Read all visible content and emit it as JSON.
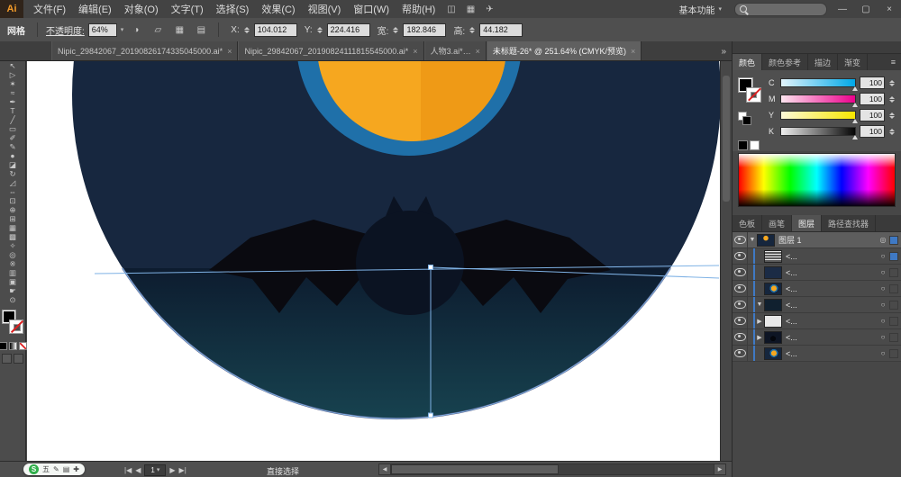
{
  "window": {
    "app": "Ai",
    "workspace_switcher": "基本功能",
    "caret": "▾",
    "minimize": "—",
    "restore": "▢",
    "close": "×"
  },
  "menubar": {
    "items": [
      "文件(F)",
      "编辑(E)",
      "对象(O)",
      "文字(T)",
      "选择(S)",
      "效果(C)",
      "视图(V)",
      "窗口(W)",
      "帮助(H)"
    ],
    "icons": [
      {
        "name": "bridge",
        "glyph": "◫"
      },
      {
        "name": "arrange-documents",
        "glyph": "▦"
      },
      {
        "name": "cs-live",
        "glyph": "✈"
      }
    ]
  },
  "controlbar": {
    "selection_type": "网格",
    "opacity_label": "不透明度:",
    "opacity_value": "64%",
    "icons": [
      {
        "name": "recolor-artwork",
        "glyph": "◑"
      },
      {
        "name": "graphic-style",
        "glyph": "▱"
      },
      {
        "name": "mesh-grid",
        "glyph": "▦"
      },
      {
        "name": "align",
        "glyph": "▤"
      }
    ],
    "fields": [
      {
        "label": "X:",
        "value": "104.012"
      },
      {
        "label": "Y:",
        "value": "224.416"
      },
      {
        "label": "宽:",
        "value": "182.846"
      },
      {
        "label": "高:",
        "value": "44.182"
      }
    ]
  },
  "tabbar": {
    "tabs": [
      {
        "label": "Nipic_29842067_20190826174335045000.ai*"
      },
      {
        "label": "Nipic_29842067_20190824111815545000.ai*"
      },
      {
        "label": "人物3.ai*…"
      },
      {
        "label": "未标题-26* @ 251.64% (CMYK/预览)"
      }
    ],
    "close_glyph": "×",
    "overflow_glyph": "»"
  },
  "toolbar": {
    "tools": [
      {
        "name": "selection",
        "glyph": "↖"
      },
      {
        "name": "direct-selection",
        "glyph": "▷"
      },
      {
        "name": "magic-wand",
        "glyph": "✶"
      },
      {
        "name": "lasso",
        "glyph": "≈"
      },
      {
        "name": "pen",
        "glyph": "✒"
      },
      {
        "name": "type",
        "glyph": "T"
      },
      {
        "name": "line-segment",
        "glyph": "╱"
      },
      {
        "name": "rectangle",
        "glyph": "▭"
      },
      {
        "name": "paintbrush",
        "glyph": "✐"
      },
      {
        "name": "pencil",
        "glyph": "✎"
      },
      {
        "name": "blob-brush",
        "glyph": "●"
      },
      {
        "name": "eraser",
        "glyph": "◪"
      },
      {
        "name": "rotate",
        "glyph": "↻"
      },
      {
        "name": "scale",
        "glyph": "◿"
      },
      {
        "name": "width",
        "glyph": "⇔"
      },
      {
        "name": "free-transform",
        "glyph": "⊡"
      },
      {
        "name": "shape-builder",
        "glyph": "⊕"
      },
      {
        "name": "perspective-grid",
        "glyph": "⊞"
      },
      {
        "name": "mesh",
        "glyph": "▦"
      },
      {
        "name": "gradient",
        "glyph": "▩"
      },
      {
        "name": "eyedropper",
        "glyph": "✧"
      },
      {
        "name": "blend",
        "glyph": "◎"
      },
      {
        "name": "symbol-sprayer",
        "glyph": "※"
      },
      {
        "name": "column-graph",
        "glyph": "▥"
      },
      {
        "name": "artboard",
        "glyph": "▣"
      },
      {
        "name": "hand",
        "glyph": "☛"
      },
      {
        "name": "zoom",
        "glyph": "⊙"
      }
    ]
  },
  "canvas": {
    "colors": {
      "big_circle": "#17273F",
      "lower_top": "#0D1C2F",
      "lower_bottom": "#17424F",
      "rim": "#565A80",
      "ring": "#1F70A9",
      "moon": "#F6A71F",
      "moon_shade": "#EF9A16",
      "bat_wing": "#0A0A10",
      "bat_body": "#0B1322",
      "selection": "#7FB2E5"
    }
  },
  "right_panel": {
    "color_panel": {
      "tabs": [
        "颜色",
        "颜色参考",
        "描边",
        "渐变"
      ],
      "menu_glyph": "≡",
      "channels": [
        {
          "label": "C",
          "value": "100"
        },
        {
          "label": "M",
          "value": "100"
        },
        {
          "label": "Y",
          "value": "100"
        },
        {
          "label": "K",
          "value": "100"
        }
      ]
    },
    "dock_tabs": {
      "tabs": [
        "色板",
        "画笔",
        "图层",
        "路径查找器"
      ]
    },
    "layers": {
      "rows": [
        {
          "label": "图层 1",
          "caret": "▼",
          "target": "◎"
        },
        {
          "label": "<...",
          "caret": "",
          "target": "○"
        },
        {
          "label": "<...",
          "caret": "",
          "target": "○"
        },
        {
          "label": "<...",
          "caret": "",
          "target": "○"
        },
        {
          "label": "<...",
          "caret": "▼",
          "target": "○"
        },
        {
          "label": "<...",
          "caret": "▶",
          "target": "○"
        },
        {
          "label": "<...",
          "caret": "▶",
          "target": "○"
        },
        {
          "label": "<...",
          "caret": "",
          "target": "○"
        }
      ]
    }
  },
  "statusbar": {
    "ime": {
      "logo": "S",
      "items": [
        "五",
        "✎",
        "▤",
        "✚"
      ]
    },
    "nav": {
      "first": "|◀",
      "prev": "◀",
      "value": "1",
      "dropdown": "▾",
      "next": "▶",
      "last": "▶|"
    },
    "tool_name": "直接选择",
    "scroll_left": "◀",
    "scroll_right": "▶"
  }
}
